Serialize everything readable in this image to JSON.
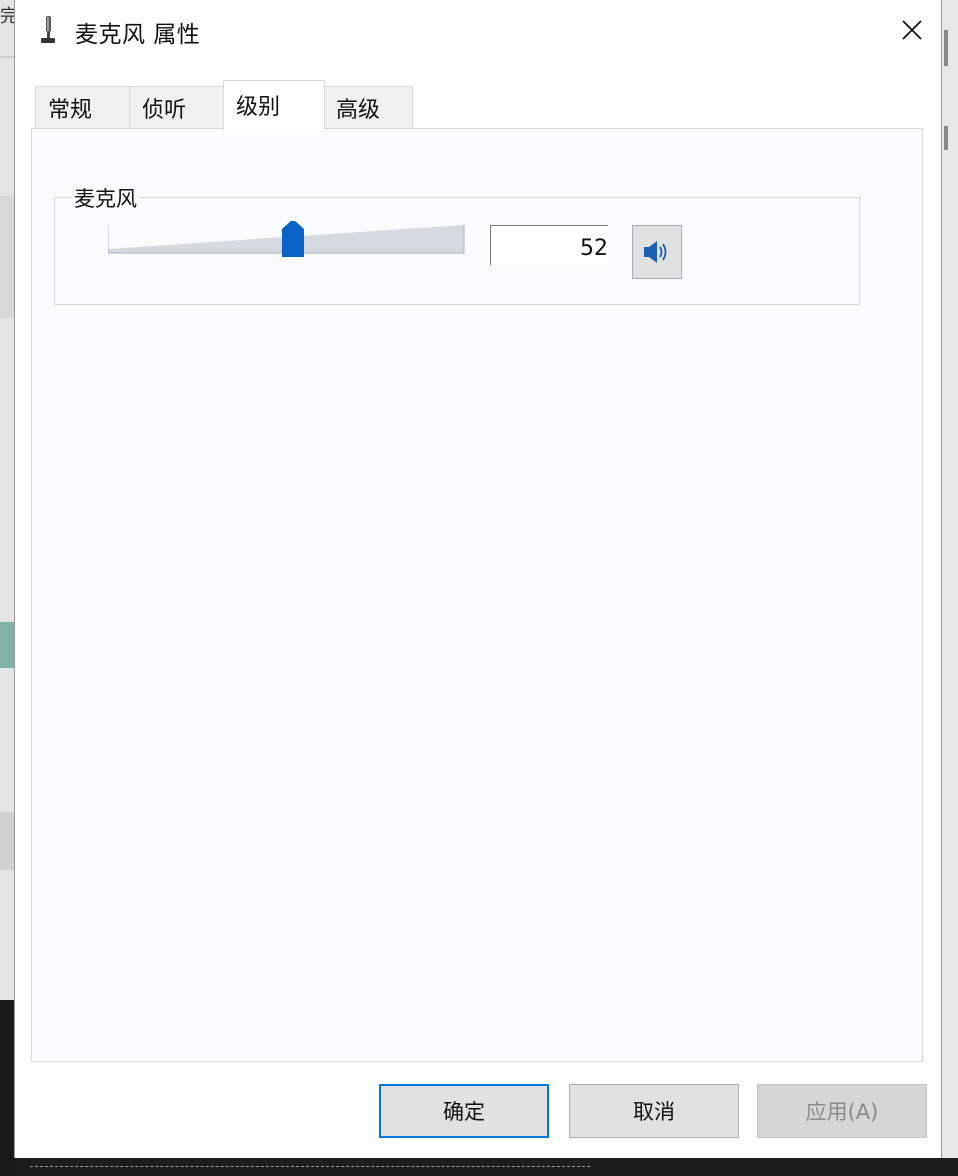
{
  "window": {
    "title": "麦克风 属性",
    "close_icon": "close-icon"
  },
  "background": {
    "left_fragment_text": "完"
  },
  "tabs": [
    {
      "label": "常规",
      "active": false
    },
    {
      "label": "侦听",
      "active": false
    },
    {
      "label": "级别",
      "active": true
    },
    {
      "label": "高级",
      "active": false
    }
  ],
  "levels": {
    "group_label": "麦克风",
    "level": 52,
    "level_max": 100,
    "level_text": "52",
    "mute_icon": "speaker-icon"
  },
  "buttons": {
    "ok": "确定",
    "cancel": "取消",
    "apply": "应用(A)"
  },
  "colors": {
    "accent": "#0078d7",
    "slider_thumb": "#0a64c8",
    "track": "#d4dae0"
  }
}
